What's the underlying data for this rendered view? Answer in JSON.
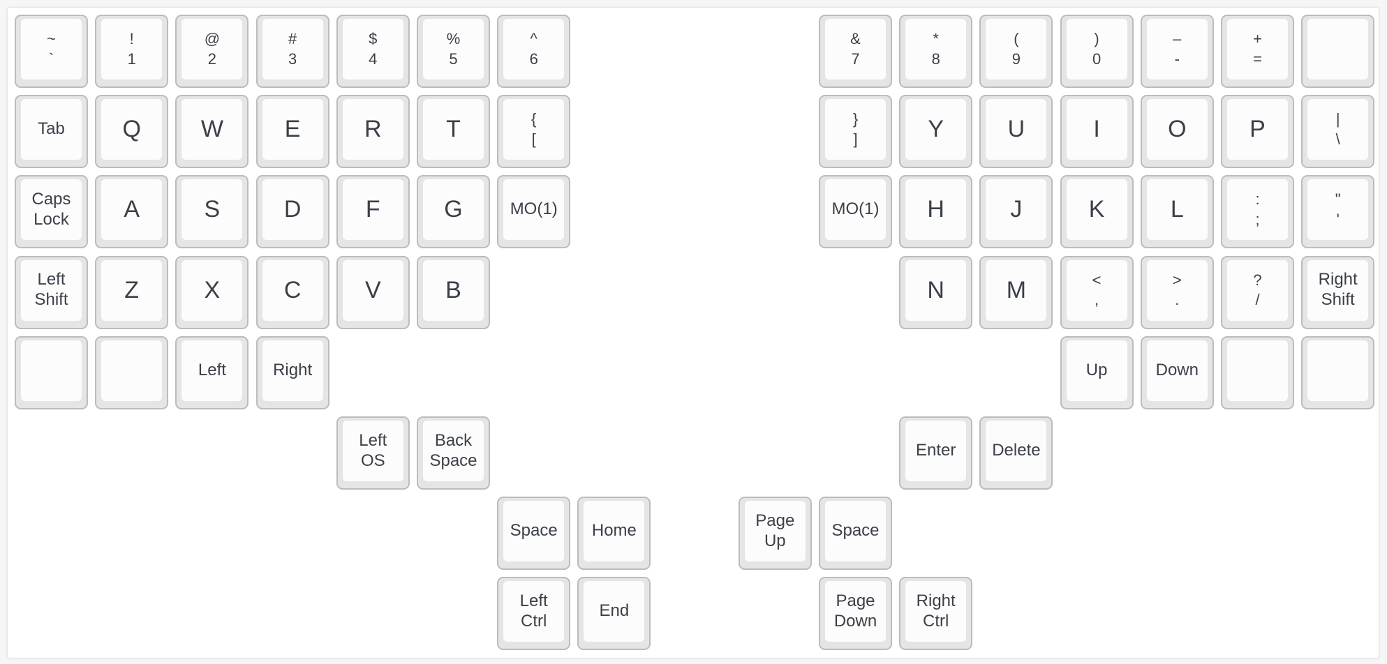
{
  "keyboard": {
    "left": {
      "row1": [
        {
          "top": "~",
          "bottom": "`"
        },
        {
          "top": "!",
          "bottom": "1"
        },
        {
          "top": "@",
          "bottom": "2"
        },
        {
          "top": "#",
          "bottom": "3"
        },
        {
          "top": "$",
          "bottom": "4"
        },
        {
          "top": "%",
          "bottom": "5"
        },
        {
          "top": "^",
          "bottom": "6"
        }
      ],
      "row2": [
        {
          "label": "Tab"
        },
        {
          "label": "Q"
        },
        {
          "label": "W"
        },
        {
          "label": "E"
        },
        {
          "label": "R"
        },
        {
          "label": "T"
        },
        {
          "top": "{",
          "bottom": "["
        }
      ],
      "row3": [
        {
          "top": "Caps",
          "bottom": "Lock"
        },
        {
          "label": "A"
        },
        {
          "label": "S"
        },
        {
          "label": "D"
        },
        {
          "label": "F"
        },
        {
          "label": "G"
        },
        {
          "label": "MO(1)"
        }
      ],
      "row4": [
        {
          "top": "Left",
          "bottom": "Shift"
        },
        {
          "label": "Z"
        },
        {
          "label": "X"
        },
        {
          "label": "C"
        },
        {
          "label": "V"
        },
        {
          "label": "B"
        }
      ],
      "row5": [
        {
          "label": ""
        },
        {
          "label": ""
        },
        {
          "label": "Left"
        },
        {
          "label": "Right"
        }
      ],
      "thumb1": [
        {
          "top": "Left",
          "bottom": "OS"
        },
        {
          "top": "Back",
          "bottom": "Space"
        }
      ],
      "thumb2": [
        {
          "label": "Space"
        },
        {
          "label": "Home"
        }
      ],
      "thumb3": [
        {
          "top": "Left",
          "bottom": "Ctrl"
        },
        {
          "label": "End"
        }
      ]
    },
    "right": {
      "row1": [
        {
          "top": "&",
          "bottom": "7"
        },
        {
          "top": "*",
          "bottom": "8"
        },
        {
          "top": "(",
          "bottom": "9"
        },
        {
          "top": ")",
          "bottom": "0"
        },
        {
          "top": "–",
          "bottom": "-"
        },
        {
          "top": "+",
          "bottom": "="
        },
        {
          "label": ""
        }
      ],
      "row2": [
        {
          "top": "}",
          "bottom": "]"
        },
        {
          "label": "Y"
        },
        {
          "label": "U"
        },
        {
          "label": "I"
        },
        {
          "label": "O"
        },
        {
          "label": "P"
        },
        {
          "top": "|",
          "bottom": "\\"
        }
      ],
      "row3": [
        {
          "label": "MO(1)"
        },
        {
          "label": "H"
        },
        {
          "label": "J"
        },
        {
          "label": "K"
        },
        {
          "label": "L"
        },
        {
          "top": ":",
          "bottom": ";"
        },
        {
          "top": "\"",
          "bottom": "'"
        }
      ],
      "row4": [
        {
          "label": "N"
        },
        {
          "label": "M"
        },
        {
          "top": "<",
          "bottom": ","
        },
        {
          "top": ">",
          "bottom": "."
        },
        {
          "top": "?",
          "bottom": "/"
        },
        {
          "top": "Right",
          "bottom": "Shift"
        }
      ],
      "row5": [
        {
          "label": "Up"
        },
        {
          "label": "Down"
        },
        {
          "label": ""
        },
        {
          "label": ""
        }
      ],
      "thumb1": [
        {
          "label": "Enter"
        },
        {
          "label": "Delete"
        }
      ],
      "thumb2": [
        {
          "top": "Page",
          "bottom": "Up"
        },
        {
          "label": "Space"
        }
      ],
      "thumb3": [
        {
          "top": "Page",
          "bottom": "Down"
        },
        {
          "top": "Right",
          "bottom": "Ctrl"
        }
      ]
    }
  }
}
